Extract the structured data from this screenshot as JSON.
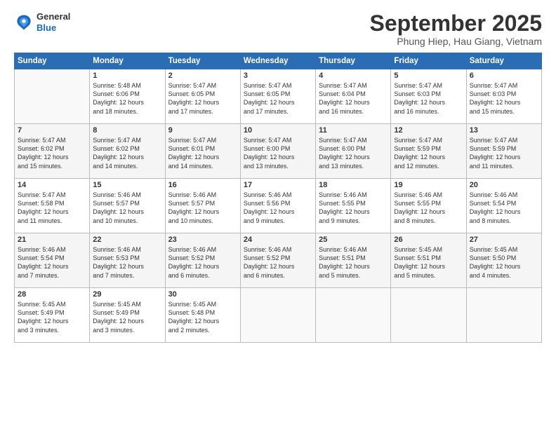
{
  "header": {
    "logo_general": "General",
    "logo_blue": "Blue",
    "title": "September 2025",
    "subtitle": "Phung Hiep, Hau Giang, Vietnam"
  },
  "days_of_week": [
    "Sunday",
    "Monday",
    "Tuesday",
    "Wednesday",
    "Thursday",
    "Friday",
    "Saturday"
  ],
  "weeks": [
    [
      {
        "day": "",
        "info": ""
      },
      {
        "day": "1",
        "info": "Sunrise: 5:48 AM\nSunset: 6:06 PM\nDaylight: 12 hours\nand 18 minutes."
      },
      {
        "day": "2",
        "info": "Sunrise: 5:47 AM\nSunset: 6:05 PM\nDaylight: 12 hours\nand 17 minutes."
      },
      {
        "day": "3",
        "info": "Sunrise: 5:47 AM\nSunset: 6:05 PM\nDaylight: 12 hours\nand 17 minutes."
      },
      {
        "day": "4",
        "info": "Sunrise: 5:47 AM\nSunset: 6:04 PM\nDaylight: 12 hours\nand 16 minutes."
      },
      {
        "day": "5",
        "info": "Sunrise: 5:47 AM\nSunset: 6:03 PM\nDaylight: 12 hours\nand 16 minutes."
      },
      {
        "day": "6",
        "info": "Sunrise: 5:47 AM\nSunset: 6:03 PM\nDaylight: 12 hours\nand 15 minutes."
      }
    ],
    [
      {
        "day": "7",
        "info": "Sunrise: 5:47 AM\nSunset: 6:02 PM\nDaylight: 12 hours\nand 15 minutes."
      },
      {
        "day": "8",
        "info": "Sunrise: 5:47 AM\nSunset: 6:02 PM\nDaylight: 12 hours\nand 14 minutes."
      },
      {
        "day": "9",
        "info": "Sunrise: 5:47 AM\nSunset: 6:01 PM\nDaylight: 12 hours\nand 14 minutes."
      },
      {
        "day": "10",
        "info": "Sunrise: 5:47 AM\nSunset: 6:00 PM\nDaylight: 12 hours\nand 13 minutes."
      },
      {
        "day": "11",
        "info": "Sunrise: 5:47 AM\nSunset: 6:00 PM\nDaylight: 12 hours\nand 13 minutes."
      },
      {
        "day": "12",
        "info": "Sunrise: 5:47 AM\nSunset: 5:59 PM\nDaylight: 12 hours\nand 12 minutes."
      },
      {
        "day": "13",
        "info": "Sunrise: 5:47 AM\nSunset: 5:59 PM\nDaylight: 12 hours\nand 11 minutes."
      }
    ],
    [
      {
        "day": "14",
        "info": "Sunrise: 5:47 AM\nSunset: 5:58 PM\nDaylight: 12 hours\nand 11 minutes."
      },
      {
        "day": "15",
        "info": "Sunrise: 5:46 AM\nSunset: 5:57 PM\nDaylight: 12 hours\nand 10 minutes."
      },
      {
        "day": "16",
        "info": "Sunrise: 5:46 AM\nSunset: 5:57 PM\nDaylight: 12 hours\nand 10 minutes."
      },
      {
        "day": "17",
        "info": "Sunrise: 5:46 AM\nSunset: 5:56 PM\nDaylight: 12 hours\nand 9 minutes."
      },
      {
        "day": "18",
        "info": "Sunrise: 5:46 AM\nSunset: 5:55 PM\nDaylight: 12 hours\nand 9 minutes."
      },
      {
        "day": "19",
        "info": "Sunrise: 5:46 AM\nSunset: 5:55 PM\nDaylight: 12 hours\nand 8 minutes."
      },
      {
        "day": "20",
        "info": "Sunrise: 5:46 AM\nSunset: 5:54 PM\nDaylight: 12 hours\nand 8 minutes."
      }
    ],
    [
      {
        "day": "21",
        "info": "Sunrise: 5:46 AM\nSunset: 5:54 PM\nDaylight: 12 hours\nand 7 minutes."
      },
      {
        "day": "22",
        "info": "Sunrise: 5:46 AM\nSunset: 5:53 PM\nDaylight: 12 hours\nand 7 minutes."
      },
      {
        "day": "23",
        "info": "Sunrise: 5:46 AM\nSunset: 5:52 PM\nDaylight: 12 hours\nand 6 minutes."
      },
      {
        "day": "24",
        "info": "Sunrise: 5:46 AM\nSunset: 5:52 PM\nDaylight: 12 hours\nand 6 minutes."
      },
      {
        "day": "25",
        "info": "Sunrise: 5:46 AM\nSunset: 5:51 PM\nDaylight: 12 hours\nand 5 minutes."
      },
      {
        "day": "26",
        "info": "Sunrise: 5:45 AM\nSunset: 5:51 PM\nDaylight: 12 hours\nand 5 minutes."
      },
      {
        "day": "27",
        "info": "Sunrise: 5:45 AM\nSunset: 5:50 PM\nDaylight: 12 hours\nand 4 minutes."
      }
    ],
    [
      {
        "day": "28",
        "info": "Sunrise: 5:45 AM\nSunset: 5:49 PM\nDaylight: 12 hours\nand 3 minutes."
      },
      {
        "day": "29",
        "info": "Sunrise: 5:45 AM\nSunset: 5:49 PM\nDaylight: 12 hours\nand 3 minutes."
      },
      {
        "day": "30",
        "info": "Sunrise: 5:45 AM\nSunset: 5:48 PM\nDaylight: 12 hours\nand 2 minutes."
      },
      {
        "day": "",
        "info": ""
      },
      {
        "day": "",
        "info": ""
      },
      {
        "day": "",
        "info": ""
      },
      {
        "day": "",
        "info": ""
      }
    ]
  ]
}
